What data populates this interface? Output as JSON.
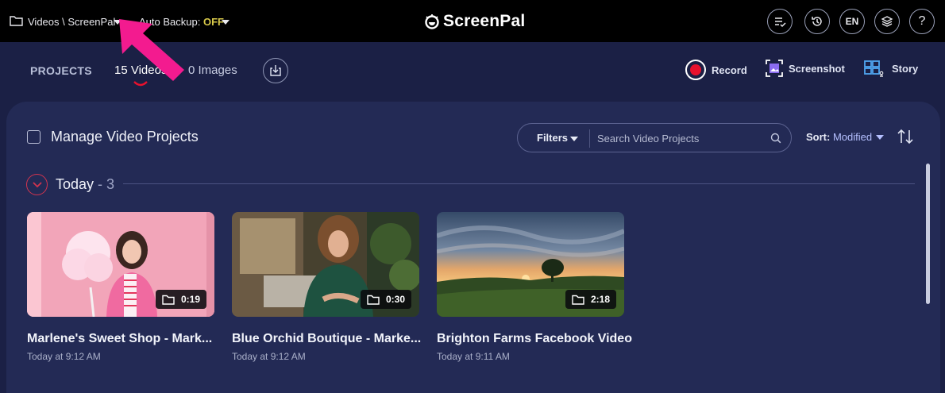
{
  "topbar": {
    "path": "Videos \\ ScreenPal",
    "backup_label": "Auto Backup:",
    "backup_value": "OFF",
    "logo_text": "ScreenPal",
    "lang": "EN",
    "help": "?"
  },
  "nav": {
    "projects": "PROJECTS",
    "videos_tab": "15 Videos",
    "images_tab": "0 Images",
    "record": "Record",
    "screenshot": "Screenshot",
    "story": "Story"
  },
  "toolbar": {
    "manage_label": "Manage Video Projects",
    "filters_label": "Filters",
    "search_placeholder": "Search Video Projects",
    "sort_label": "Sort:",
    "sort_value": "Modified"
  },
  "group": {
    "title": "Today",
    "count": " - 3"
  },
  "videos": [
    {
      "title": "Marlene's Sweet Shop - Mark...",
      "date": "Today at 9:12 AM",
      "duration": "0:19"
    },
    {
      "title": "Blue Orchid Boutique - Marke...",
      "date": "Today at 9:12 AM",
      "duration": "0:30"
    },
    {
      "title": "Brighton Farms Facebook Video",
      "date": "Today at 9:11 AM",
      "duration": "2:18"
    }
  ],
  "colors": {
    "accent_red": "#e8112d",
    "arrow_pink": "#f31b8f",
    "backup_off": "#d8c94a"
  }
}
